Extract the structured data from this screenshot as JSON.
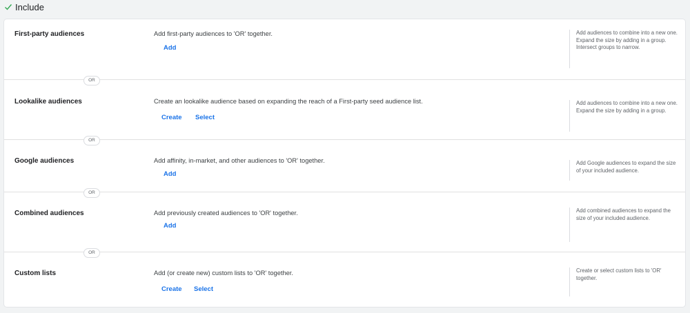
{
  "header": {
    "title": "Include"
  },
  "rows": [
    {
      "title": "First-party audiences",
      "description": "Add first-party audiences to 'OR' together.",
      "actions": [
        "Add"
      ],
      "help": "Add audiences to combine into a new one. Expand the size by adding in a group. Intersect groups to narrow."
    },
    {
      "title": "Lookalike audiences",
      "description": "Create an lookalike audience based on expanding the reach of a First-party seed audience list.",
      "actions": [
        "Create",
        "Select"
      ],
      "help": "Add audiences to combine into a new one. Expand the size by adding in a group."
    },
    {
      "title": "Google audiences",
      "description": "Add affinity, in-market, and other audiences to 'OR' together.",
      "actions": [
        "Add"
      ],
      "help": "Add Google audiences to expand the size of your included audience."
    },
    {
      "title": "Combined audiences",
      "description": "Add previously created audiences to 'OR' together.",
      "actions": [
        "Add"
      ],
      "help": "Add combined audiences to expand the size of your included audience."
    },
    {
      "title": "Custom lists",
      "description": "Add (or create new) custom lists to 'OR' together.",
      "actions": [
        "Create",
        "Select"
      ],
      "help": "Create or select custom lists to 'OR' together."
    }
  ],
  "or_label": "OR",
  "colors": {
    "accent": "#1a73e8",
    "check": "#34a853"
  }
}
